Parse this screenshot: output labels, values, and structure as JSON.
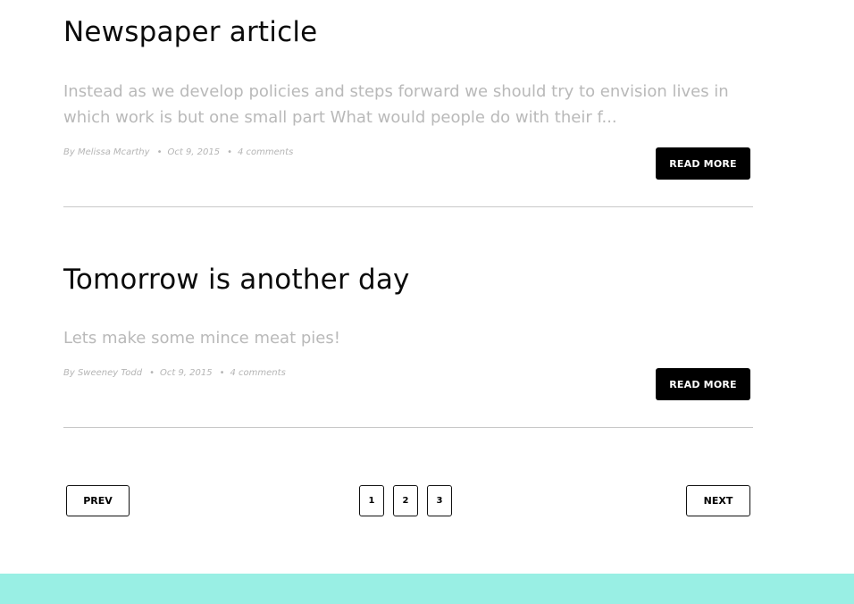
{
  "posts": [
    {
      "title": "Newspaper article",
      "excerpt": "Instead as we develop policies and steps forward we should try to envision lives in which work is but one small part What would people do with their f...",
      "author": "By Melissa Mcarthy",
      "date": "Oct 9, 2015",
      "comments": "4 comments",
      "button_label": "READ MORE"
    },
    {
      "title": "Tomorrow is another day",
      "excerpt": "Lets make some mince meat pies!",
      "author": "By Sweeney Todd",
      "date": "Oct 9, 2015",
      "comments": "4 comments",
      "button_label": "READ MORE"
    }
  ],
  "meta_separator": "•",
  "pagination": {
    "prev_label": "PREV",
    "next_label": "NEXT",
    "pages": [
      "1",
      "2",
      "3"
    ]
  },
  "colors": {
    "footer": "#99efe4",
    "excerpt_text": "#b9b9b9",
    "button": "#000000"
  }
}
